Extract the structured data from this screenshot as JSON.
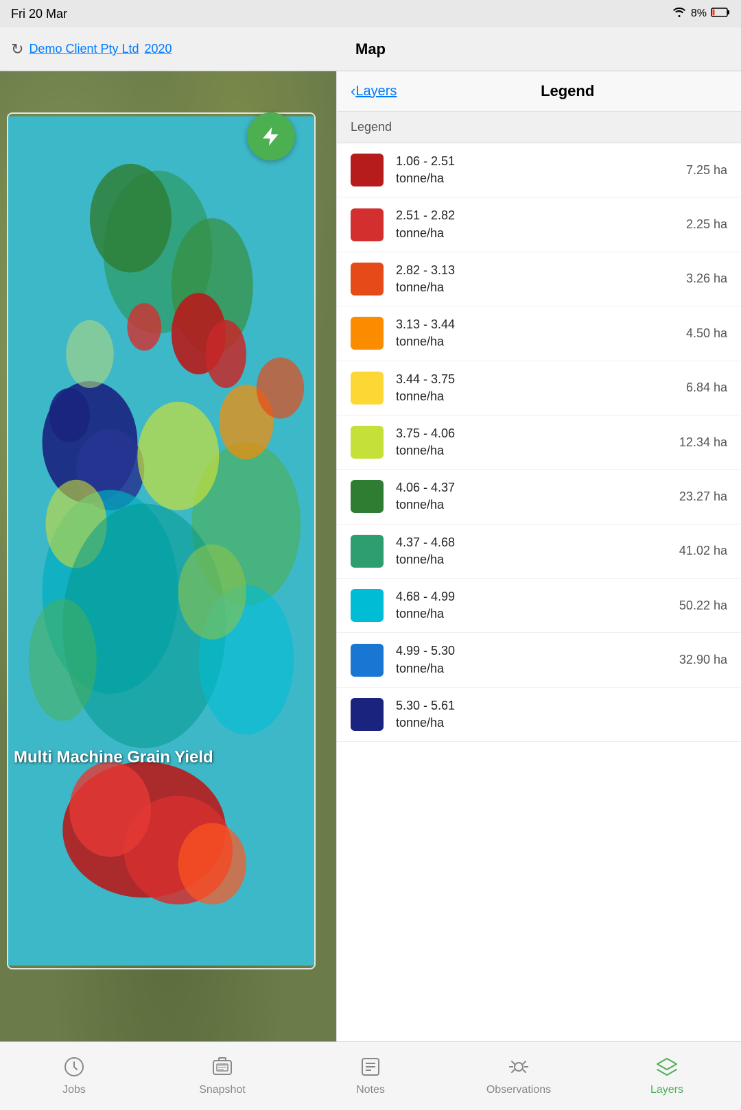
{
  "statusBar": {
    "time": "Fri 20 Mar",
    "battery": "8%"
  },
  "navBar": {
    "client": "Demo Client Pty Ltd",
    "year": "2020",
    "title": "Map"
  },
  "map": {
    "layerLabel": "Multi Machine Grain Yield"
  },
  "legendPanel": {
    "backLabel": "Layers",
    "title": "Legend",
    "sectionLabel": "Legend",
    "items": [
      {
        "range": "1.06 - 2.51\ntonne/ha",
        "ha": "7.25 ha",
        "color": "#b71c1c"
      },
      {
        "range": "2.51 - 2.82\ntonne/ha",
        "ha": "2.25 ha",
        "color": "#d32f2f"
      },
      {
        "range": "2.82 - 3.13\ntonne/ha",
        "ha": "3.26 ha",
        "color": "#e64a19"
      },
      {
        "range": "3.13 - 3.44\ntonne/ha",
        "ha": "4.50 ha",
        "color": "#fb8c00"
      },
      {
        "range": "3.44 - 3.75\ntonne/ha",
        "ha": "6.84 ha",
        "color": "#fdd835"
      },
      {
        "range": "3.75 - 4.06\ntonne/ha",
        "ha": "12.34 ha",
        "color": "#c6e03a"
      },
      {
        "range": "4.06 - 4.37\ntonne/ha",
        "ha": "23.27 ha",
        "color": "#2e7d32"
      },
      {
        "range": "4.37 - 4.68\ntonne/ha",
        "ha": "41.02 ha",
        "color": "#2e9e6e"
      },
      {
        "range": "4.68 - 4.99\ntonne/ha",
        "ha": "50.22 ha",
        "color": "#00bcd4"
      },
      {
        "range": "4.99 - 5.30\ntonne/ha",
        "ha": "32.90 ha",
        "color": "#1976d2"
      },
      {
        "range": "5.30 - 5.61\ntonne/ha",
        "ha": "...",
        "color": "#1a237e"
      }
    ]
  },
  "tabBar": {
    "tabs": [
      {
        "id": "jobs",
        "label": "Jobs",
        "active": false
      },
      {
        "id": "snapshot",
        "label": "Snapshot",
        "active": false
      },
      {
        "id": "notes",
        "label": "Notes",
        "active": false
      },
      {
        "id": "observations",
        "label": "Observations",
        "active": false
      },
      {
        "id": "layers",
        "label": "Layers",
        "active": true
      }
    ]
  }
}
